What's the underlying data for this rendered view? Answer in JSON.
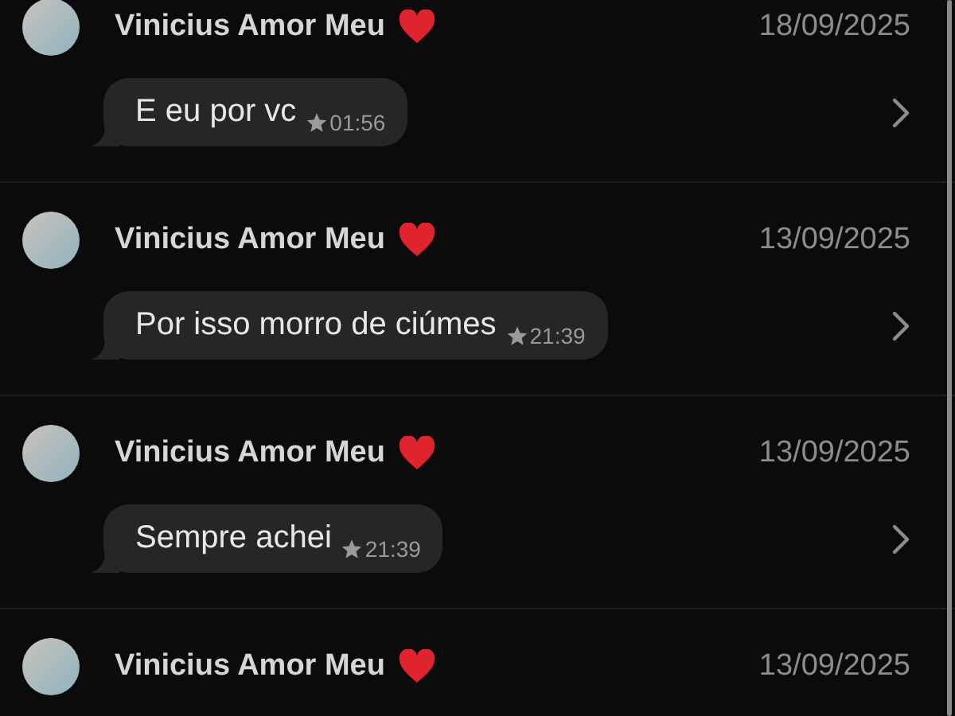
{
  "starred_messages": [
    {
      "sender": "Vinicius Amor Meu",
      "date": "18/09/2025",
      "message": "E eu por vc",
      "time": "01:56"
    },
    {
      "sender": "Vinicius Amor Meu",
      "date": "13/09/2025",
      "message": "Por isso morro de ciúmes",
      "time": "21:39"
    },
    {
      "sender": "Vinicius Amor Meu",
      "date": "13/09/2025",
      "message": "Sempre achei",
      "time": "21:39"
    },
    {
      "sender": "Vinicius Amor Meu",
      "date": "13/09/2025"
    }
  ]
}
